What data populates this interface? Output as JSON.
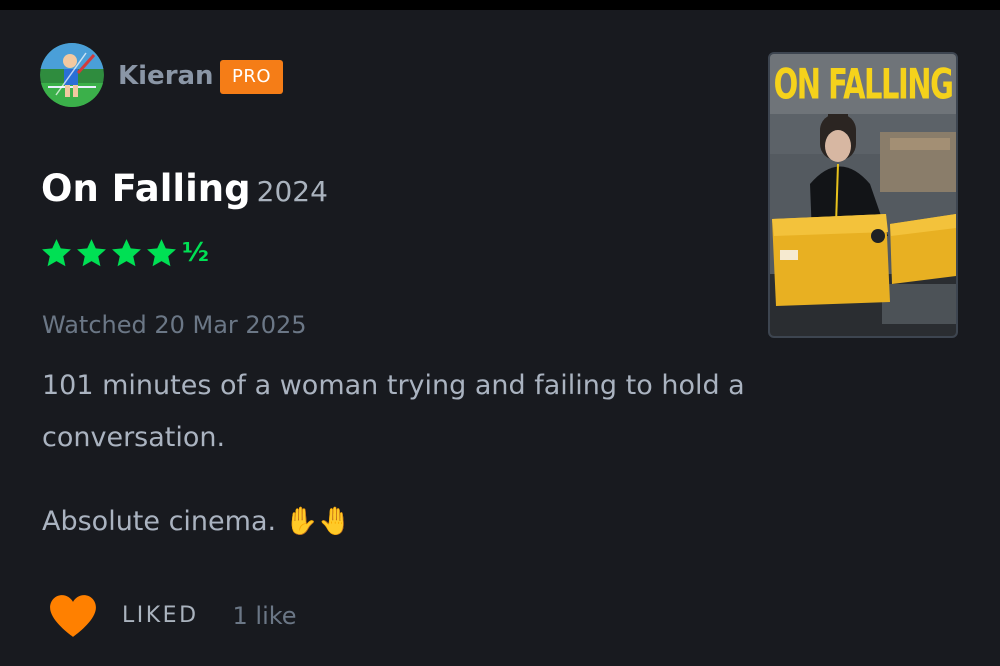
{
  "user": {
    "name": "Kieran",
    "badge": "PRO"
  },
  "film": {
    "title": "On Falling",
    "year": "2024",
    "rating_stars": 4.5,
    "rating_half_glyph": "½",
    "poster_title": "ON FALLING"
  },
  "watched": "Watched 20 Mar 2025",
  "review": {
    "paragraph_1": "101 minutes of a woman trying and failing to hold a conversation.",
    "paragraph_2": "Absolute cinema. ✋🤚"
  },
  "actions": {
    "liked_label": "LIKED",
    "like_count": "1 like"
  },
  "colors": {
    "background": "#181a1f",
    "pro_badge": "#f57d17",
    "star": "#00e054",
    "heart": "#ff8000",
    "poster_title": "#f5d21b"
  },
  "icons": {
    "avatar": "avatar-image",
    "stars": "star-icon",
    "heart": "heart-icon"
  }
}
